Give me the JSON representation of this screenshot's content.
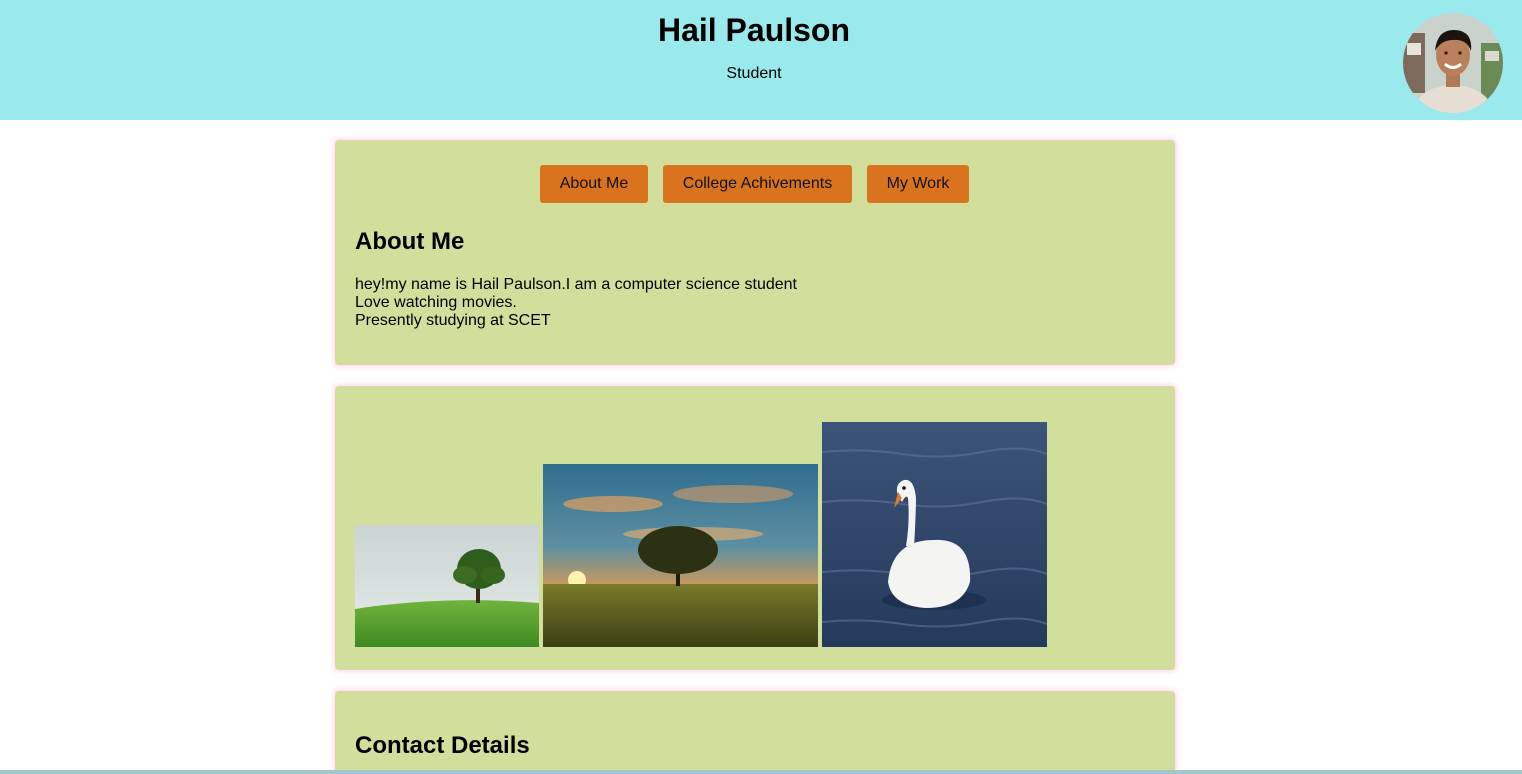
{
  "header": {
    "name": "Hail Paulson",
    "role": "Student"
  },
  "nav": {
    "buttons": [
      "About Me",
      "College Achivements",
      "My Work"
    ]
  },
  "about": {
    "title": "About Me",
    "lines": [
      "hey!my name is Hail Paulson.I am a computer science student",
      "Love watching movies.",
      "Presently studying at SCET"
    ]
  },
  "gallery": {
    "images": [
      "tree-on-grass-photo",
      "tree-at-sunset-photo",
      "swan-on-water-photo"
    ]
  },
  "contact": {
    "title": "Contact Details"
  },
  "colors": {
    "header_bg": "#9ae9ec",
    "card_bg": "#d1de9c",
    "button_bg": "#d9731d"
  }
}
